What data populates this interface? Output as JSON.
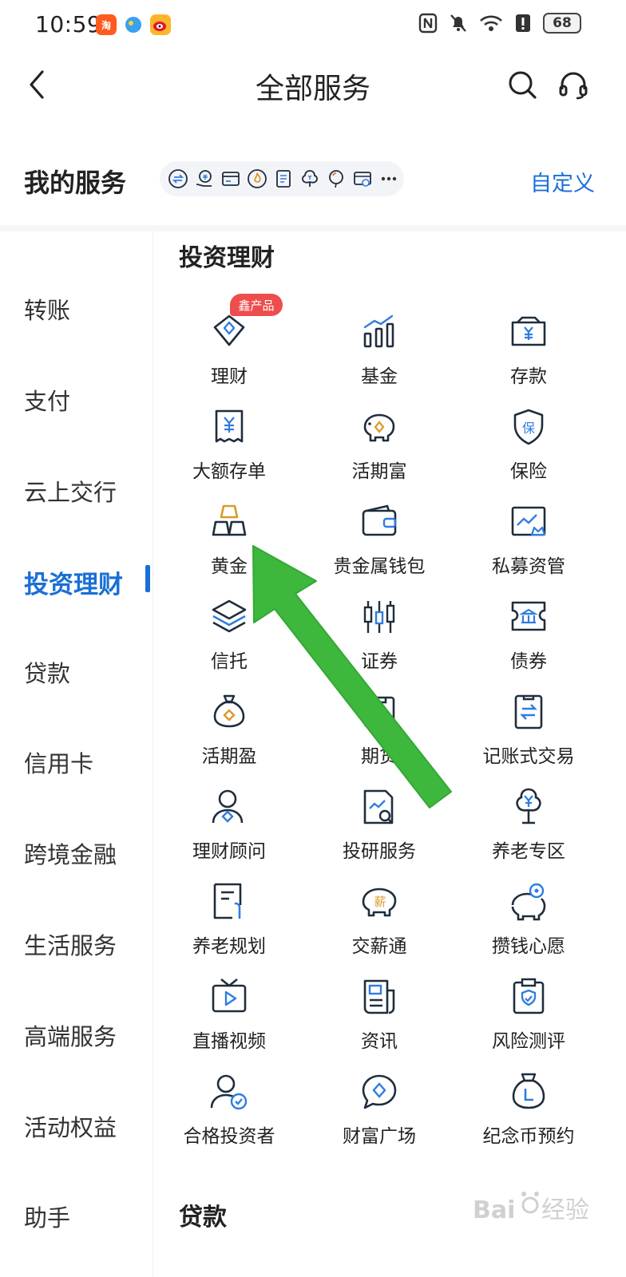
{
  "status_bar": {
    "time": "10:59",
    "battery": "68"
  },
  "header": {
    "title": "全部服务",
    "back_icon": "chevron-left-icon",
    "search_icon": "search-icon",
    "service_icon": "headset-icon"
  },
  "my_services": {
    "title": "我的服务",
    "customize": "自定义",
    "shortcut_icons": [
      "transfer-icon",
      "money-hand-icon",
      "card-icon",
      "fire-icon",
      "document-icon",
      "tree-icon",
      "balloon-icon",
      "wallet-card-icon",
      "more-icon"
    ]
  },
  "nav": {
    "items": [
      {
        "label": "转账"
      },
      {
        "label": "支付"
      },
      {
        "label": "云上交行"
      },
      {
        "label": "投资理财"
      },
      {
        "label": "贷款"
      },
      {
        "label": "信用卡"
      },
      {
        "label": "跨境金融"
      },
      {
        "label": "生活服务"
      },
      {
        "label": "高端服务"
      },
      {
        "label": "活动权益"
      },
      {
        "label": "助手"
      }
    ],
    "active": "投资理财"
  },
  "sections": {
    "invest": {
      "title": "投资理财",
      "badge": "鑫产品",
      "items": [
        {
          "label": "理财",
          "icon": "diamond-tag-icon"
        },
        {
          "label": "基金",
          "icon": "bar-chart-icon"
        },
        {
          "label": "存款",
          "icon": "yen-box-icon"
        },
        {
          "label": "大额存单",
          "icon": "receipt-icon"
        },
        {
          "label": "活期富",
          "icon": "piggy-bank-icon"
        },
        {
          "label": "保险",
          "icon": "shield-icon"
        },
        {
          "label": "黄金",
          "icon": "gold-bars-icon"
        },
        {
          "label": "贵金属钱包",
          "icon": "wallet-icon"
        },
        {
          "label": "私募资管",
          "icon": "chart-crown-icon"
        },
        {
          "label": "信托",
          "icon": "layers-icon"
        },
        {
          "label": "证券",
          "icon": "candlestick-icon"
        },
        {
          "label": "债券",
          "icon": "bank-ticket-icon"
        },
        {
          "label": "活期盈",
          "icon": "money-bag-icon"
        },
        {
          "label": "期货",
          "icon": "futures-icon"
        },
        {
          "label": "记账式交易",
          "icon": "exchange-doc-icon"
        },
        {
          "label": "理财顾问",
          "icon": "advisor-icon"
        },
        {
          "label": "投研服务",
          "icon": "research-icon"
        },
        {
          "label": "养老专区",
          "icon": "yen-tree-icon"
        },
        {
          "label": "养老规划",
          "icon": "plan-doc-icon"
        },
        {
          "label": "交薪通",
          "icon": "salary-pig-icon"
        },
        {
          "label": "攒钱心愿",
          "icon": "wish-pig-icon"
        },
        {
          "label": "直播视频",
          "icon": "tv-play-icon"
        },
        {
          "label": "资讯",
          "icon": "news-icon"
        },
        {
          "label": "风险测评",
          "icon": "risk-clipboard-icon"
        },
        {
          "label": "合格投资者",
          "icon": "verified-user-icon"
        },
        {
          "label": "财富广场",
          "icon": "chat-diamond-icon"
        },
        {
          "label": "纪念币预约",
          "icon": "coin-bag-icon"
        }
      ]
    },
    "loan": {
      "title": "贷款"
    }
  },
  "colors": {
    "accent": "#1a6fd6",
    "icon_stroke": "#1f2d3d",
    "icon_highlight": "#2f7de1",
    "gold": "#d99a2b",
    "badge": "#ee4d4d",
    "arrow": "#3db83d"
  }
}
